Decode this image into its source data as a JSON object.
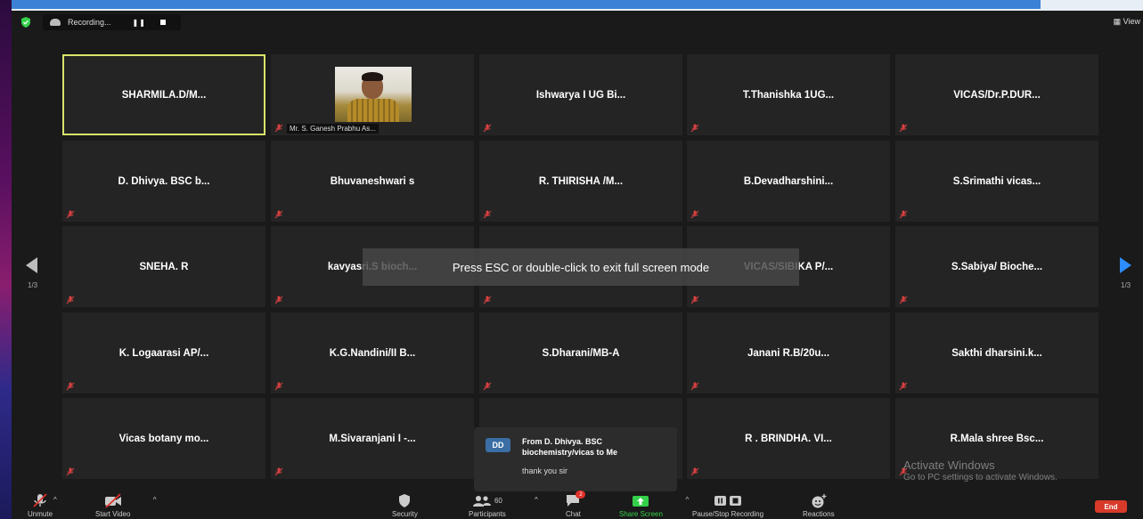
{
  "top_bar": {
    "recording_label": "Recording...",
    "pause_symbol": "❚❚",
    "view_label": "View"
  },
  "tiles": [
    {
      "name": "SHARMILA.D/M...",
      "active": true
    },
    {
      "name": "",
      "caption": "Mr. S. Ganesh Prabhu As...",
      "has_photo": true
    },
    {
      "name": "Ishwarya I UG Bi..."
    },
    {
      "name": "T.Thanishka 1UG..."
    },
    {
      "name": "VICAS/Dr.P.DUR..."
    },
    {
      "name": "D. Dhivya. BSC b..."
    },
    {
      "name": "Bhuvaneshwari s"
    },
    {
      "name": "R. THIRISHA /M..."
    },
    {
      "name": "B.Devadharshini..."
    },
    {
      "name": "S.Srimathi vicas..."
    },
    {
      "name": "SNEHA. R"
    },
    {
      "name": "kavyasri.S bioch..."
    },
    {
      "name": ""
    },
    {
      "name": "VICAS/SIBIKA P/..."
    },
    {
      "name": "S.Sabiya/ Bioche..."
    },
    {
      "name": "K. Logaarasi AP/..."
    },
    {
      "name": "K.G.Nandini/II B..."
    },
    {
      "name": "S.Dharani/MB-A"
    },
    {
      "name": "Janani R.B/20u..."
    },
    {
      "name": "Sakthi dharsini.k..."
    },
    {
      "name": "Vicas botany mo..."
    },
    {
      "name": "M.Sivaranjani I -..."
    },
    {
      "name": ""
    },
    {
      "name": "R . BRINDHA. VI..."
    },
    {
      "name": "R.Mala shree Bsc..."
    }
  ],
  "pagination": {
    "left_page": "1/3",
    "right_page": "1/3"
  },
  "fullscreen_toast": "Press ESC or double-click to exit full screen mode",
  "chat_popup": {
    "avatar_initials": "DD",
    "from": "From D. Dhivya. BSC biochemistry/vicas to Me",
    "message": "thank you sir"
  },
  "watermark": {
    "title": "Activate Windows",
    "subtitle": "Go to PC settings to activate Windows."
  },
  "toolbar": {
    "unmute": "Unmute",
    "start_video": "Start Video",
    "security": "Security",
    "participants": "Participants",
    "participants_count": "60",
    "chat": "Chat",
    "chat_badge": "2",
    "share_screen": "Share Screen",
    "pause_stop_recording": "Pause/Stop Recording",
    "reactions": "Reactions",
    "end": "End"
  },
  "colors": {
    "active_speaker_border": "#d7e46a",
    "share_green": "#35d04a",
    "end_red": "#d83a2a",
    "arrow_blue": "#2d8cff"
  }
}
